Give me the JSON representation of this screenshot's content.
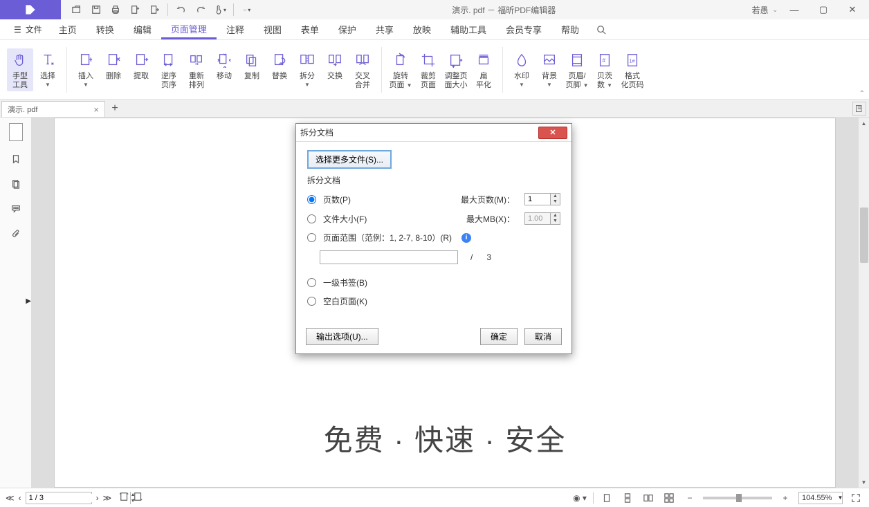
{
  "app": {
    "title": "演示. pdf － 福昕PDF编辑器",
    "user": "若愚"
  },
  "menus": {
    "file": "文件",
    "items": [
      "主页",
      "转换",
      "编辑",
      "页面管理",
      "注释",
      "视图",
      "表单",
      "保护",
      "共享",
      "放映",
      "辅助工具",
      "会员专享",
      "帮助"
    ],
    "active_index": 3
  },
  "ribbon": {
    "hand": "手型",
    "tool": "工具",
    "select": "选择",
    "insert": "插入",
    "delete": "删除",
    "extract": "提取",
    "reverse": "逆序",
    "page_order": "页序",
    "rearrange": "重新",
    "arrange": "排列",
    "move": "移动",
    "copy": "复制",
    "replace": "替换",
    "split": "拆分",
    "swap": "交换",
    "cross": "交叉",
    "merge": "合并",
    "rotate": "旋转",
    "page": "页面",
    "crop": "裁剪",
    "resize": "调整页",
    "size": "面大小",
    "flatten": "扁",
    "flatten2": "平化",
    "watermark": "水印",
    "background": "背景",
    "header": "页眉/",
    "footer": "页脚",
    "bates": "贝茨",
    "number": "数",
    "format": "格式",
    "pagenum": "化页码"
  },
  "tab": {
    "name": "演示. pdf"
  },
  "page_content": "免费 · 快速 · 安全",
  "status": {
    "page_display": "1 / 3",
    "zoom": "104.55%"
  },
  "dialog": {
    "title": "拆分文档",
    "select_more": "选择更多文件(S)...",
    "section": "拆分文档",
    "opt_pages": "页数(P)",
    "max_pages": "最大页数(M)：",
    "pages_value": "1",
    "opt_size": "文件大小(F)",
    "max_mb": "最大MB(X)：",
    "mb_value": "1.00",
    "opt_range": "页面范围（范例：1, 2-7, 8-10）(R)",
    "range_sep": "/",
    "total_pages": "3",
    "opt_bookmark": "一级书签(B)",
    "opt_blank": "空白页面(K)",
    "output": "输出选项(U)...",
    "ok": "确定",
    "cancel": "取消"
  }
}
